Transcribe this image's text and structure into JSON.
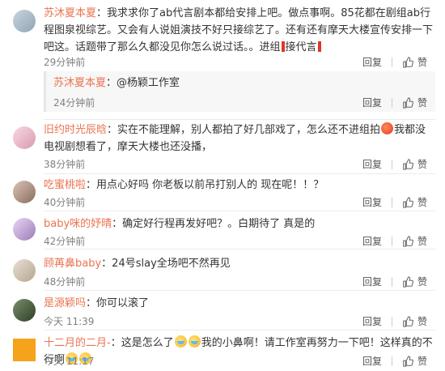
{
  "actions": {
    "reply_label": "回复",
    "like_label": "赞"
  },
  "comments": [
    {
      "user": "苏沐夏本夏",
      "text1": "：我求求你了ab代言剧本都给安排上吧。做点事啊。85花都在剧组ab行程图泉视综艺。又会有人说姐演技不好只接综艺了。还有还有摩天大楼宣传安排一下吧这。话题带了那么久都没见你怎么说过话。。进组",
      "text2": "接代言",
      "time": "29分钟前"
    },
    {
      "user": "苏沐夏本夏",
      "text1": "：@杨颖工作室",
      "time": "24分钟前"
    },
    {
      "user": "旧约时光辰晗",
      "text1": "：实在不能理解，别人都拍了好几部戏了，怎么还不进组拍",
      "text2": "我都没电视剧想看了，摩天大楼也还没播，",
      "time": "38分钟前"
    },
    {
      "user": "吃蜜桃啦",
      "text1": "：用点心好吗 你老板以前吊打别人的 现在呢！！？",
      "time": "40分钟前"
    },
    {
      "user": "baby咪的妤晴",
      "text1": "：确定好行程再发好吧？。白期待了 真是的",
      "time": "42分钟前"
    },
    {
      "user": "顾苒鼻baby",
      "text1": "：24号slay全场吧不然再见",
      "time": "48分钟前"
    },
    {
      "user": "是源颖吗",
      "text1": "：你可以滚了",
      "time": "今天 11:39"
    },
    {
      "user": "十二月的二月-",
      "text1": "：这是怎么了",
      "text2": "我的小鼻啊！请工作室再努力一下吧！这样真的不行啊",
      "time": "今天 11:17"
    }
  ],
  "colors": {
    "username": "#eb7350",
    "time": "#808080",
    "text": "#333333"
  }
}
